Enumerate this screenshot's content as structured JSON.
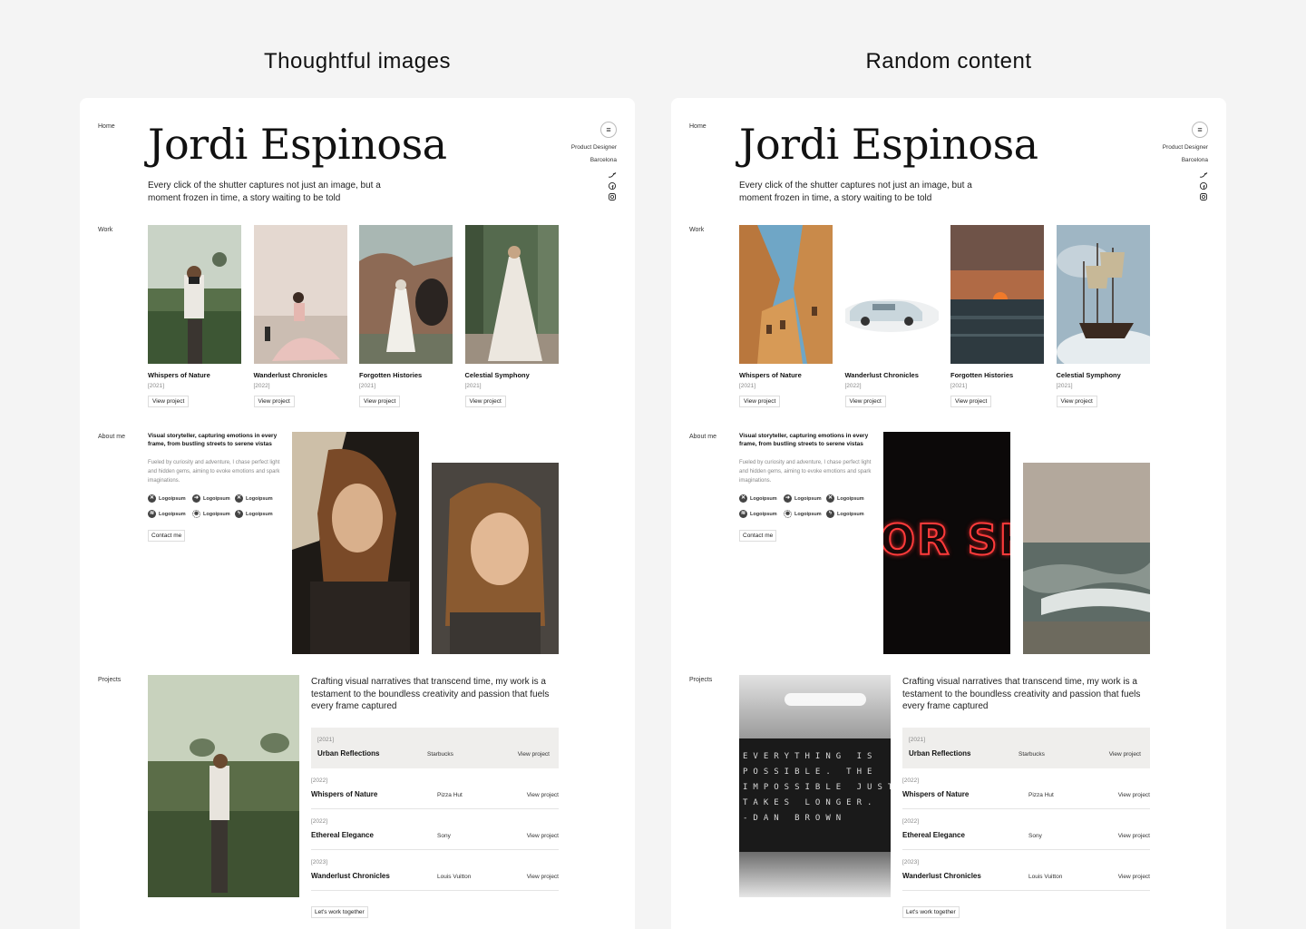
{
  "headings": {
    "left": "Thoughtful images",
    "right": "Random content"
  },
  "site": {
    "nav_home": "Home",
    "name": "Jordi Espinosa",
    "tagline": "Every click of the shutter captures not just an image, but a moment frozen in time, a story waiting to be told",
    "role": "Product Designer",
    "city": "Barcelona",
    "menu_icon": "≡",
    "social_icons": [
      "twitter-icon",
      "facebook-icon",
      "instagram-icon"
    ],
    "sections": {
      "work": "Work",
      "about": "About me",
      "projects": "Projects"
    },
    "work": [
      {
        "title": "Whispers of Nature",
        "year": "[2021]",
        "cta": "View project"
      },
      {
        "title": "Wanderlust Chronicles",
        "year": "[2022]",
        "cta": "View project"
      },
      {
        "title": "Forgotten Histories",
        "year": "[2021]",
        "cta": "View project"
      },
      {
        "title": "Celestial Symphony",
        "year": "[2021]",
        "cta": "View project"
      }
    ],
    "about": {
      "title": "Visual storyteller, capturing emotions in every frame, from bustling streets to serene vistas",
      "body": "Fueled by curiosity and adventure, I chase perfect light and hidden gems, aiming to evoke emotions and spark imaginations.",
      "logos": [
        "Logoipsum",
        "Logoipsum",
        "Logoipsum",
        "Logoipsum",
        "Logoipsum",
        "Logoipsum"
      ],
      "contact": "Contact me"
    },
    "projects": {
      "intro": "Crafting visual narratives that transcend time, my work is a testament to the boundless creativity and passion that fuels every frame captured",
      "rows": [
        {
          "year": "[2021]",
          "name": "Urban Reflections",
          "client": "Starbucks",
          "link": "View project"
        },
        {
          "year": "[2022]",
          "name": "Whispers of Nature",
          "client": "Pizza Hut",
          "link": "View project"
        },
        {
          "year": "[2022]",
          "name": "Ethereal Elegance",
          "client": "Sony",
          "link": "View project"
        },
        {
          "year": "[2023]",
          "name": "Wanderlust Chronicles",
          "client": "Louis Vuitton",
          "link": "View project"
        }
      ],
      "cta": "Let's work together"
    }
  },
  "right_quote_lines": [
    "EVERYTHING IS",
    "POSSIBLE. THE",
    "IMPOSSIBLE JUST",
    "TAKES LONGER.",
    "-DAN BROWN"
  ],
  "right_neon_text": "OR SH",
  "colors": {
    "page_bg": "#f4f4f4",
    "panel_bg": "#ffffff",
    "highlight_row": "#efeeec"
  }
}
